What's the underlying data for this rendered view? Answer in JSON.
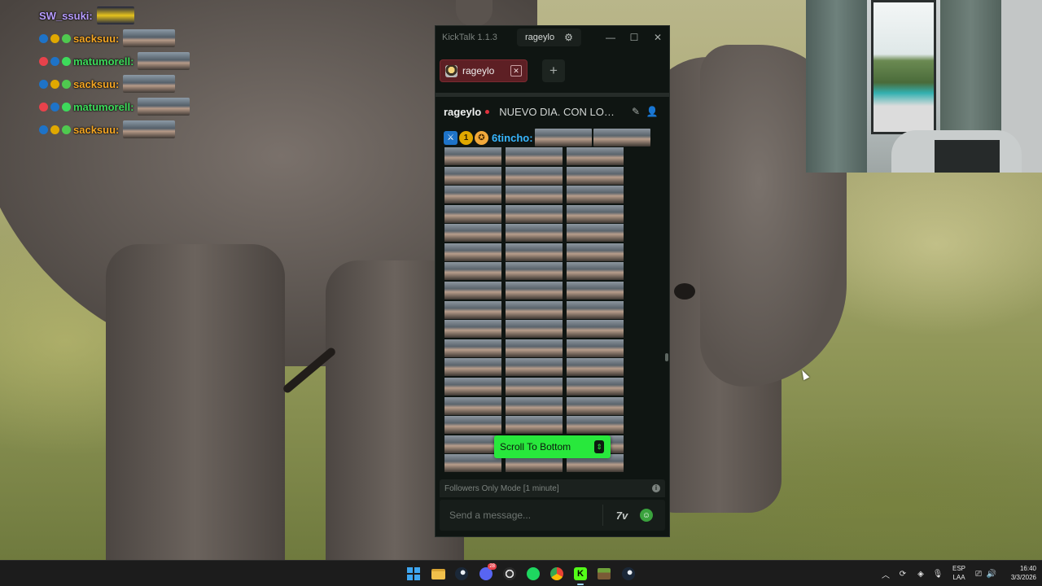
{
  "overlay_chat": [
    {
      "user": "SW_ssuki:",
      "color": "#b79cff",
      "badges": [],
      "emote": "yellow"
    },
    {
      "user": "sacksuu:",
      "color": "#f5a623",
      "badges": [
        "#1e73c8",
        "#e0a800",
        "#4fc94f"
      ],
      "emote": "face"
    },
    {
      "user": "matumorell:",
      "color": "#3ddb5b",
      "badges": [
        "#e8424b",
        "#1e73c8",
        "#3ddb5b"
      ],
      "emote": "face"
    },
    {
      "user": "sacksuu:",
      "color": "#f5a623",
      "badges": [
        "#1e73c8",
        "#e0a800",
        "#4fc94f"
      ],
      "emote": "face"
    },
    {
      "user": "matumorell:",
      "color": "#3ddb5b",
      "badges": [
        "#e8424b",
        "#1e73c8",
        "#3ddb5b"
      ],
      "emote": "face"
    },
    {
      "user": "sacksuu:",
      "color": "#f5a623",
      "badges": [
        "#1e73c8",
        "#e0a800",
        "#4fc94f"
      ],
      "emote": "face"
    }
  ],
  "kicktalk": {
    "app_title": "KickTalk 1.1.3",
    "current_user": "rageylo",
    "tab_label": "rageylo",
    "channel": {
      "name": "rageylo",
      "stream_title": "NUEVO DIA. CON LOS TI..."
    },
    "message": {
      "user": "6tincho:",
      "badge_sub": "1",
      "emote_count_first_row": 2
    },
    "emote_grid_rows": 17,
    "scroll_to_bottom_label": "Scroll To Bottom",
    "mode_notice": "Followers Only Mode [1 minute]",
    "input_placeholder": "Send a message...",
    "seventv_label": "7v",
    "colors": {
      "accent_green": "#28e83c",
      "tab_bg": "#5d1f24",
      "user_blue": "#37b6ff"
    }
  },
  "taskbar": {
    "apps": [
      "start-icon",
      "file-explorer-icon",
      "steam-icon",
      "discord-icon",
      "obs-icon",
      "spotify-icon",
      "chrome-icon",
      "kick-icon",
      "minecraft-icon",
      "steam-icon"
    ],
    "discord_badge": "28",
    "language": "ESP",
    "keyboard": "LAA",
    "time": "16:40",
    "date": "3/3/2026"
  }
}
